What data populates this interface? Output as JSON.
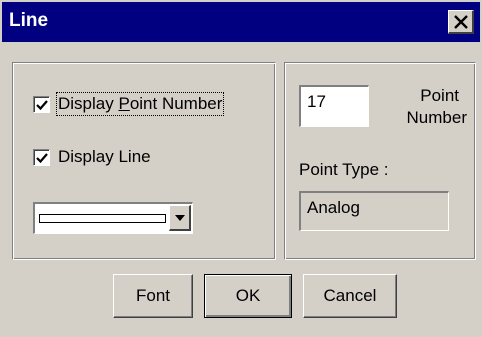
{
  "window": {
    "title": "Line"
  },
  "display": {
    "point_number_pre": "Display ",
    "point_number_mnemonic": "P",
    "point_number_post": "oint Number",
    "point_number_checked": true,
    "line_label": "Display Line",
    "line_checked": true,
    "line_style_combo": "solid-white-line"
  },
  "point": {
    "number_value": "17",
    "number_label_line1": "Point",
    "number_label_line2": "Number",
    "type_label": "Point Type :",
    "type_value": "Analog"
  },
  "buttons": {
    "font": "Font",
    "ok": "OK",
    "cancel": "Cancel"
  }
}
